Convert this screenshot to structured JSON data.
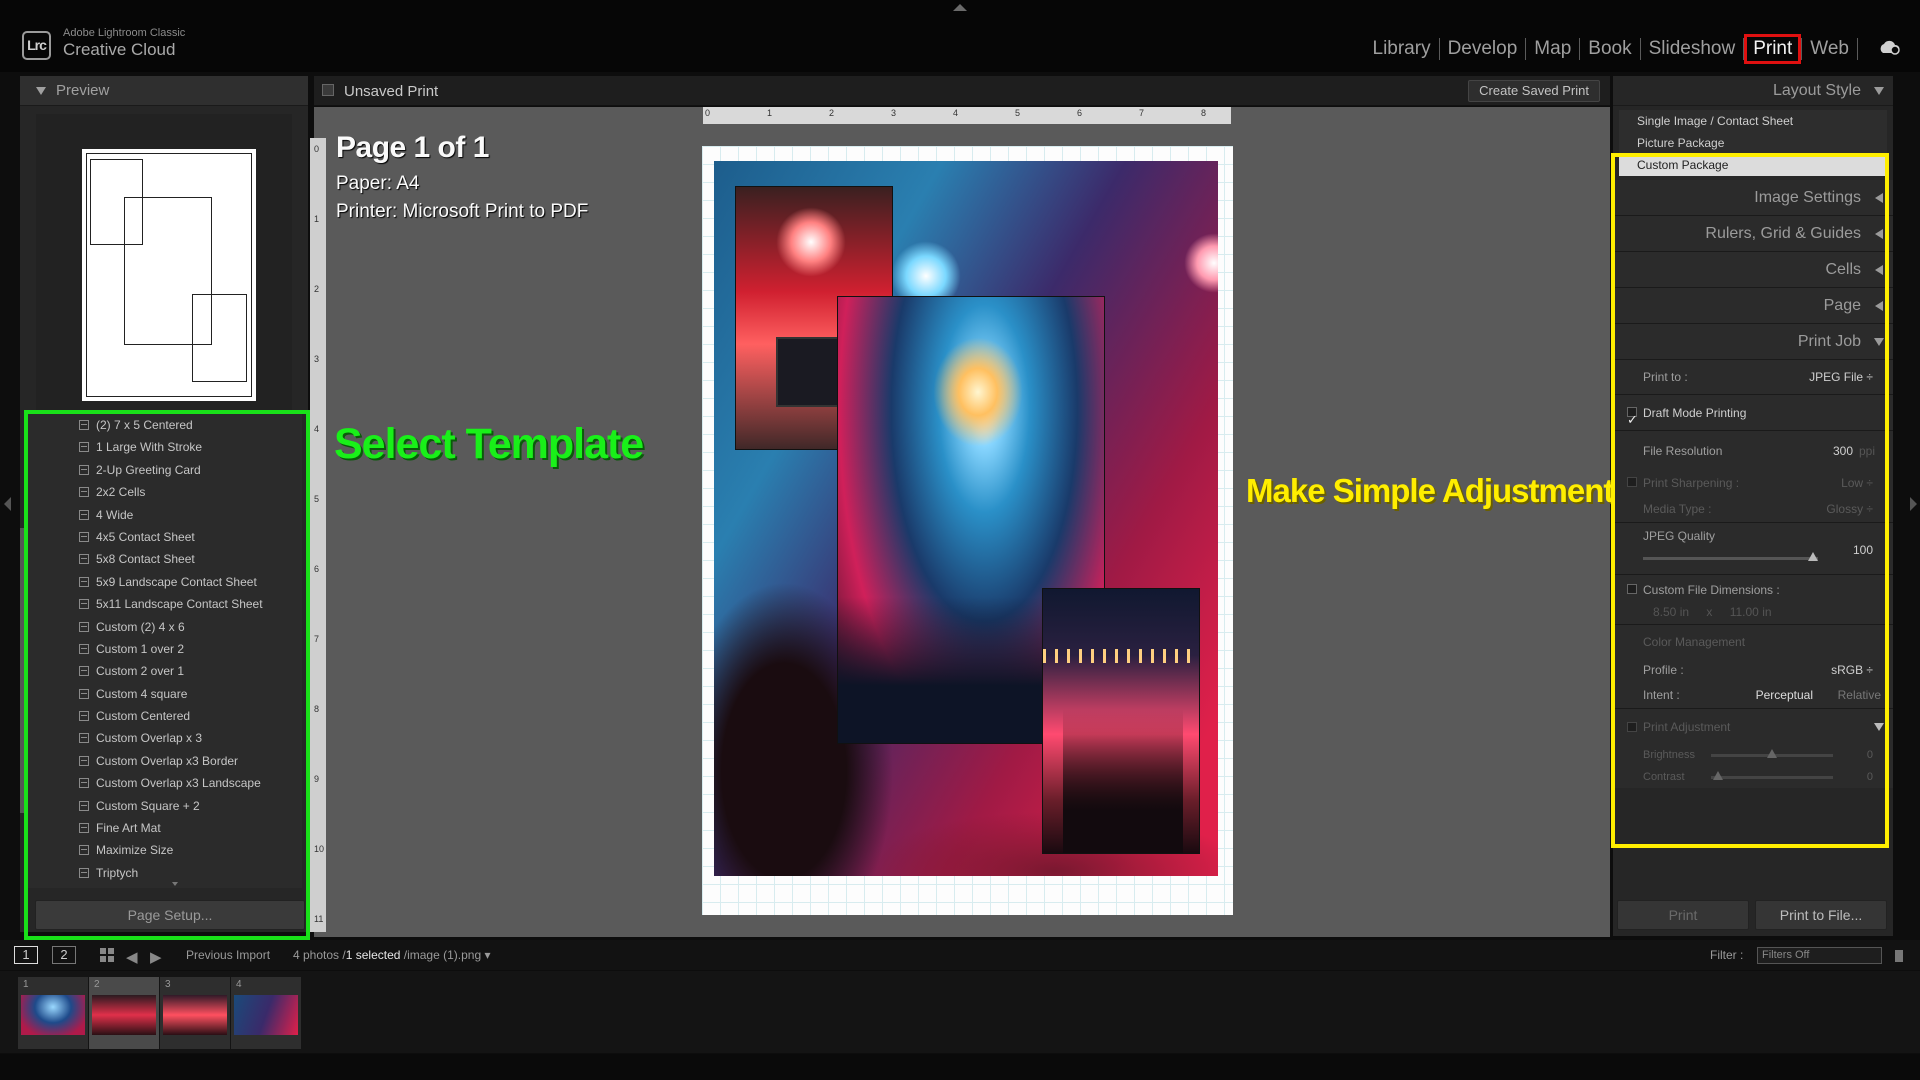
{
  "app": {
    "brand_small": "Adobe Lightroom Classic",
    "brand_large": "Creative Cloud",
    "logo_text": "Lrc"
  },
  "modules": [
    "Library",
    "Develop",
    "Map",
    "Book",
    "Slideshow",
    "Print",
    "Web"
  ],
  "active_module": "Print",
  "left_panel": {
    "preview_title": "Preview",
    "templates": [
      "(2) 7 x 5 Centered",
      "1 Large With Stroke",
      "2-Up Greeting Card",
      "2x2 Cells",
      "4 Wide",
      "4x5 Contact Sheet",
      "5x8 Contact Sheet",
      "5x9 Landscape Contact Sheet",
      "5x11 Landscape Contact Sheet",
      "Custom (2) 4 x 6",
      "Custom 1 over 2",
      "Custom 2 over 1",
      "Custom 4 square",
      "Custom Centered",
      "Custom Overlap x 3",
      "Custom Overlap x3 Border",
      "Custom Overlap x3 Landscape",
      "Custom Square + 2",
      "Fine Art Mat",
      "Maximize Size",
      "Triptych"
    ],
    "page_setup_label": "Page Setup..."
  },
  "center": {
    "title": "Unsaved Print",
    "create_saved_print": "Create Saved Print",
    "page_info_title": "Page 1 of 1",
    "paper_line": "Paper:  A4",
    "printer_line": "Printer:  Microsoft Print to PDF",
    "ruler_top": [
      "0",
      "1",
      "2",
      "3",
      "4",
      "5",
      "6",
      "7",
      "8"
    ],
    "ruler_left": [
      "0",
      "1",
      "2",
      "3",
      "4",
      "5",
      "6",
      "7",
      "8",
      "9",
      "10",
      "11"
    ]
  },
  "annotations": {
    "green_text": "Select Template",
    "yellow_text": "Make Simple Adjustments",
    "green_color": "#19e019",
    "yellow_color": "#ffee00",
    "red_color": "#e01010"
  },
  "right_panel": {
    "layout_style_title": "Layout Style",
    "layout_options": [
      "Single Image / Contact Sheet",
      "Picture Package",
      "Custom Package"
    ],
    "selected_layout": "Custom Package",
    "sections": [
      "Image Settings",
      "Rulers, Grid & Guides",
      "Cells",
      "Page"
    ],
    "print_job_title": "Print Job",
    "print_to_label": "Print to :",
    "print_to_value": "JPEG File ÷",
    "draft_mode_label": "Draft Mode Printing",
    "draft_mode_checked": true,
    "file_resolution_label": "File Resolution",
    "file_resolution_value": "300",
    "file_resolution_unit": "ppi",
    "print_sharpening_label": "Print Sharpening :",
    "print_sharpening_value": "Low ÷",
    "media_type_label": "Media Type :",
    "media_type_value": "Glossy ÷",
    "jpeg_quality_label": "JPEG Quality",
    "jpeg_quality_value": "100",
    "jpeg_quality_fraction": 1.0,
    "custom_dims_label": "Custom File Dimensions :",
    "custom_dims_w": "8.50 in",
    "custom_dims_x": "x",
    "custom_dims_h": "11.00 in",
    "color_management_label": "Color Management",
    "profile_label": "Profile :",
    "profile_value": "sRGB ÷",
    "intent_label": "Intent :",
    "intent_perceptual": "Perceptual",
    "intent_relative": "Relative",
    "print_adjustment_label": "Print Adjustment",
    "brightness_label": "Brightness",
    "brightness_value": "0",
    "contrast_label": "Contrast",
    "contrast_value": "0",
    "print_label": "Print",
    "print_to_file_label": "Print to File..."
  },
  "filmbar": {
    "page1": "1",
    "page2": "2",
    "source": "Previous Import",
    "count_prefix": "4 photos /",
    "selected": "1 selected",
    "file": "/image (1).png",
    "filter_label": "Filter :",
    "filter_value": "Filters Off"
  },
  "filmstrip": [
    "1",
    "2",
    "3",
    "4"
  ]
}
